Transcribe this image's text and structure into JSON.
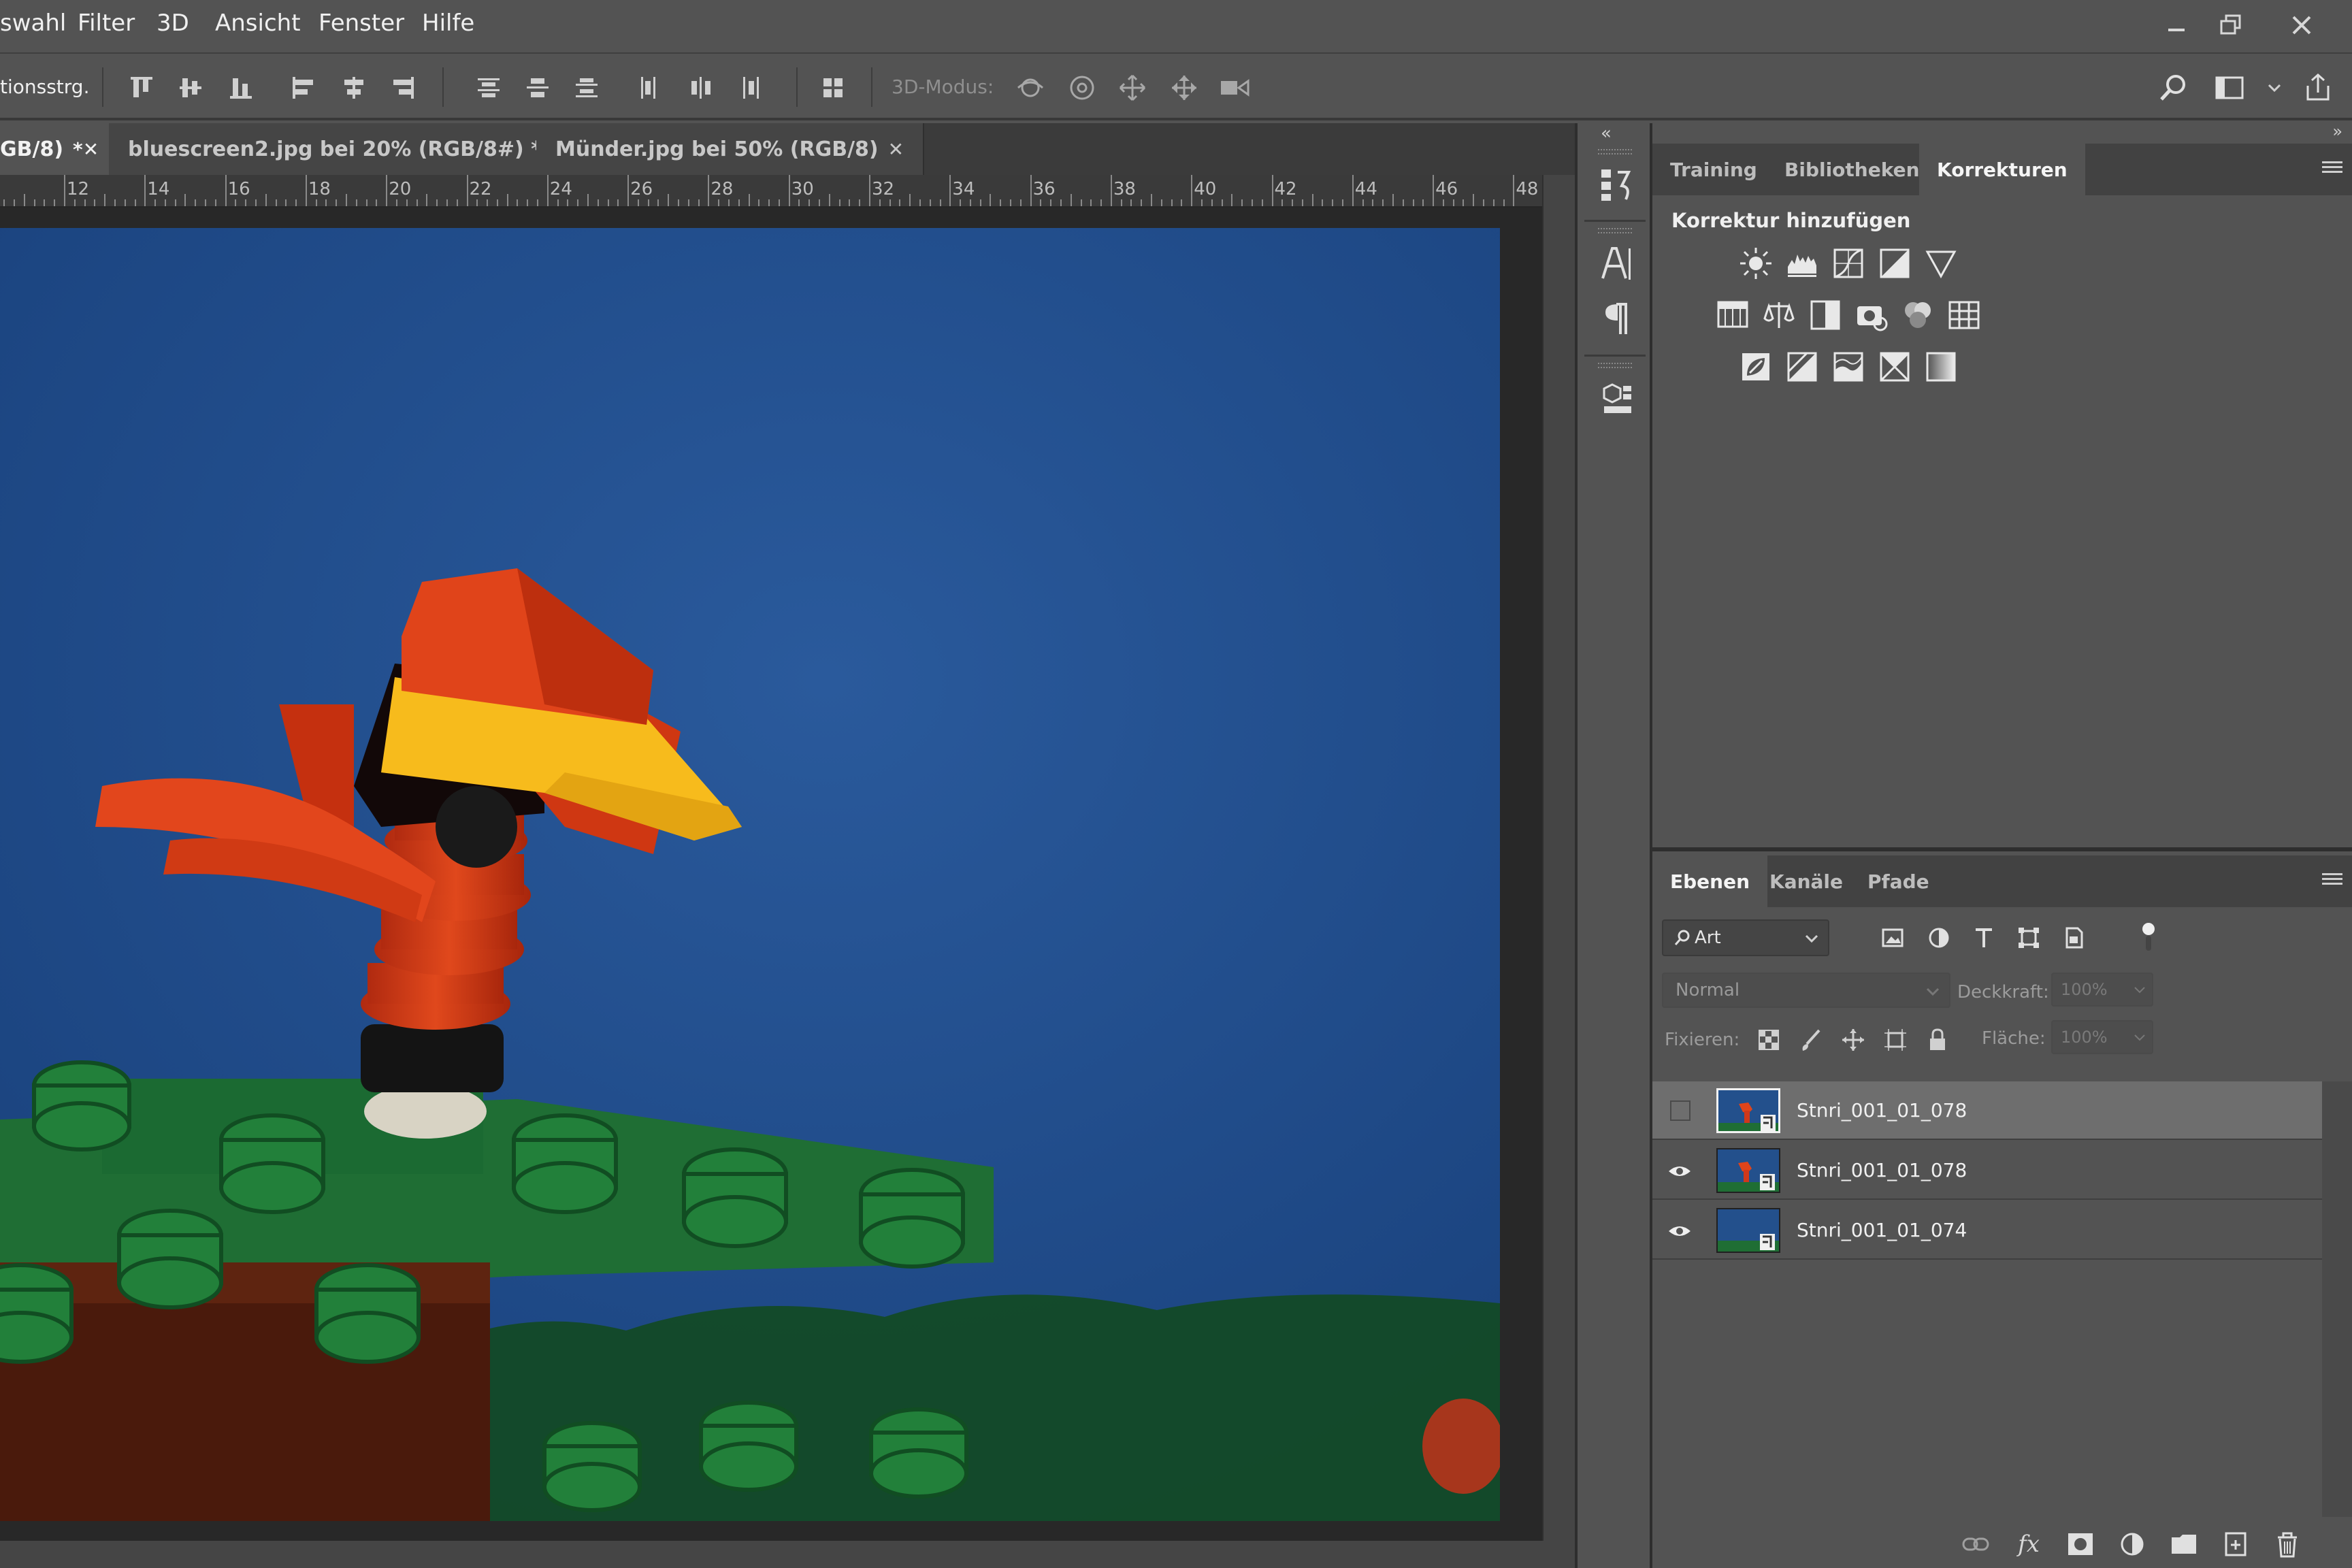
{
  "menu": {
    "items": [
      "swahl",
      "Filter",
      "3D",
      "Ansicht",
      "Fenster",
      "Hilfe"
    ]
  },
  "options": {
    "left_label": "tionsstrg.",
    "mode_label": "3D-Modus:"
  },
  "document_tabs": [
    {
      "label": "GB/8)",
      "close": "*✕",
      "active": true
    },
    {
      "label": "bluescreen2.jpg bei 20% (RGB/8#) *",
      "close": "✕",
      "active": false
    },
    {
      "label": "Münder.jpg bei 50% (RGB/8)",
      "close": "✕",
      "active": false
    }
  ],
  "ruler": {
    "numbers": [
      "12",
      "14",
      "16",
      "18",
      "20",
      "22",
      "24",
      "26",
      "28",
      "30",
      "32",
      "34",
      "36",
      "38",
      "40",
      "42",
      "44",
      "46",
      "48"
    ]
  },
  "adjustments_panel": {
    "tabs": [
      "Training",
      "Bibliotheken",
      "Korrekturen"
    ],
    "active_tab": "Korrekturen",
    "title": "Korrektur hinzufügen",
    "icon_rows": [
      [
        "brightness-contrast-icon",
        "levels-icon",
        "curves-icon",
        "exposure-icon",
        "vibrance-icon"
      ],
      [
        "hue-saturation-icon",
        "color-balance-icon",
        "black-white-icon",
        "photo-filter-icon",
        "channel-mixer-icon",
        "color-lookup-icon"
      ],
      [
        "invert-icon",
        "posterize-icon",
        "threshold-icon",
        "selective-color-icon",
        "gradient-map-icon"
      ]
    ]
  },
  "layers_panel": {
    "tabs": [
      "Ebenen",
      "Kanäle",
      "Pfade"
    ],
    "active_tab": "Ebenen",
    "filter_label": "Art",
    "blend_mode": "Normal",
    "opacity_label": "Deckkraft:",
    "opacity_value": "100%",
    "lock_label": "Fixieren:",
    "fill_label": "Fläche:",
    "fill_value": "100%",
    "layers": [
      {
        "name": "Stnri_001_01_078",
        "visible": false,
        "selected": true
      },
      {
        "name": "Stnri_001_01_078",
        "visible": true,
        "selected": false
      },
      {
        "name": "Stnri_001_01_074",
        "visible": true,
        "selected": false
      }
    ]
  },
  "colors": {
    "ui_bg": "#535353",
    "canvas_bg": "#282828",
    "photo_sky": "#1f4d8c",
    "lego_red": "#d23a12",
    "lego_yellow": "#f7bb1c",
    "lego_green": "#1f6e34"
  }
}
